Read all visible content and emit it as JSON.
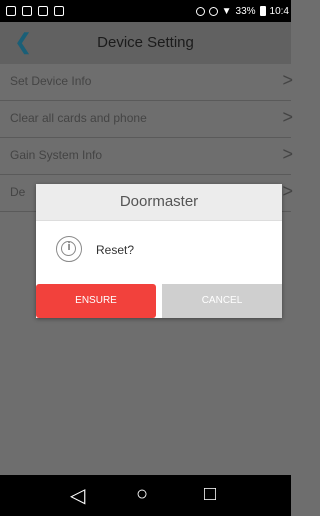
{
  "status_bar": {
    "signal": "33%",
    "time": "10:4"
  },
  "header": {
    "title": "Device Setting"
  },
  "list": {
    "items": [
      {
        "label": "Set Device Info"
      },
      {
        "label": "Clear all cards and phone"
      },
      {
        "label": "Gain System Info"
      },
      {
        "label": "De"
      }
    ]
  },
  "dialog": {
    "title": "Doormaster",
    "message": "Reset?",
    "ensure_label": "ENSURE",
    "cancel_label": "CANCEL"
  },
  "colors": {
    "accent": "#f2413c",
    "cancel": "#cfcfcf",
    "back_arrow": "#1a5f77"
  },
  "icons": [
    "back-chevron-icon",
    "chevron-right-icon",
    "info-icon",
    "back-nav-icon",
    "home-nav-icon",
    "recents-nav-icon"
  ]
}
